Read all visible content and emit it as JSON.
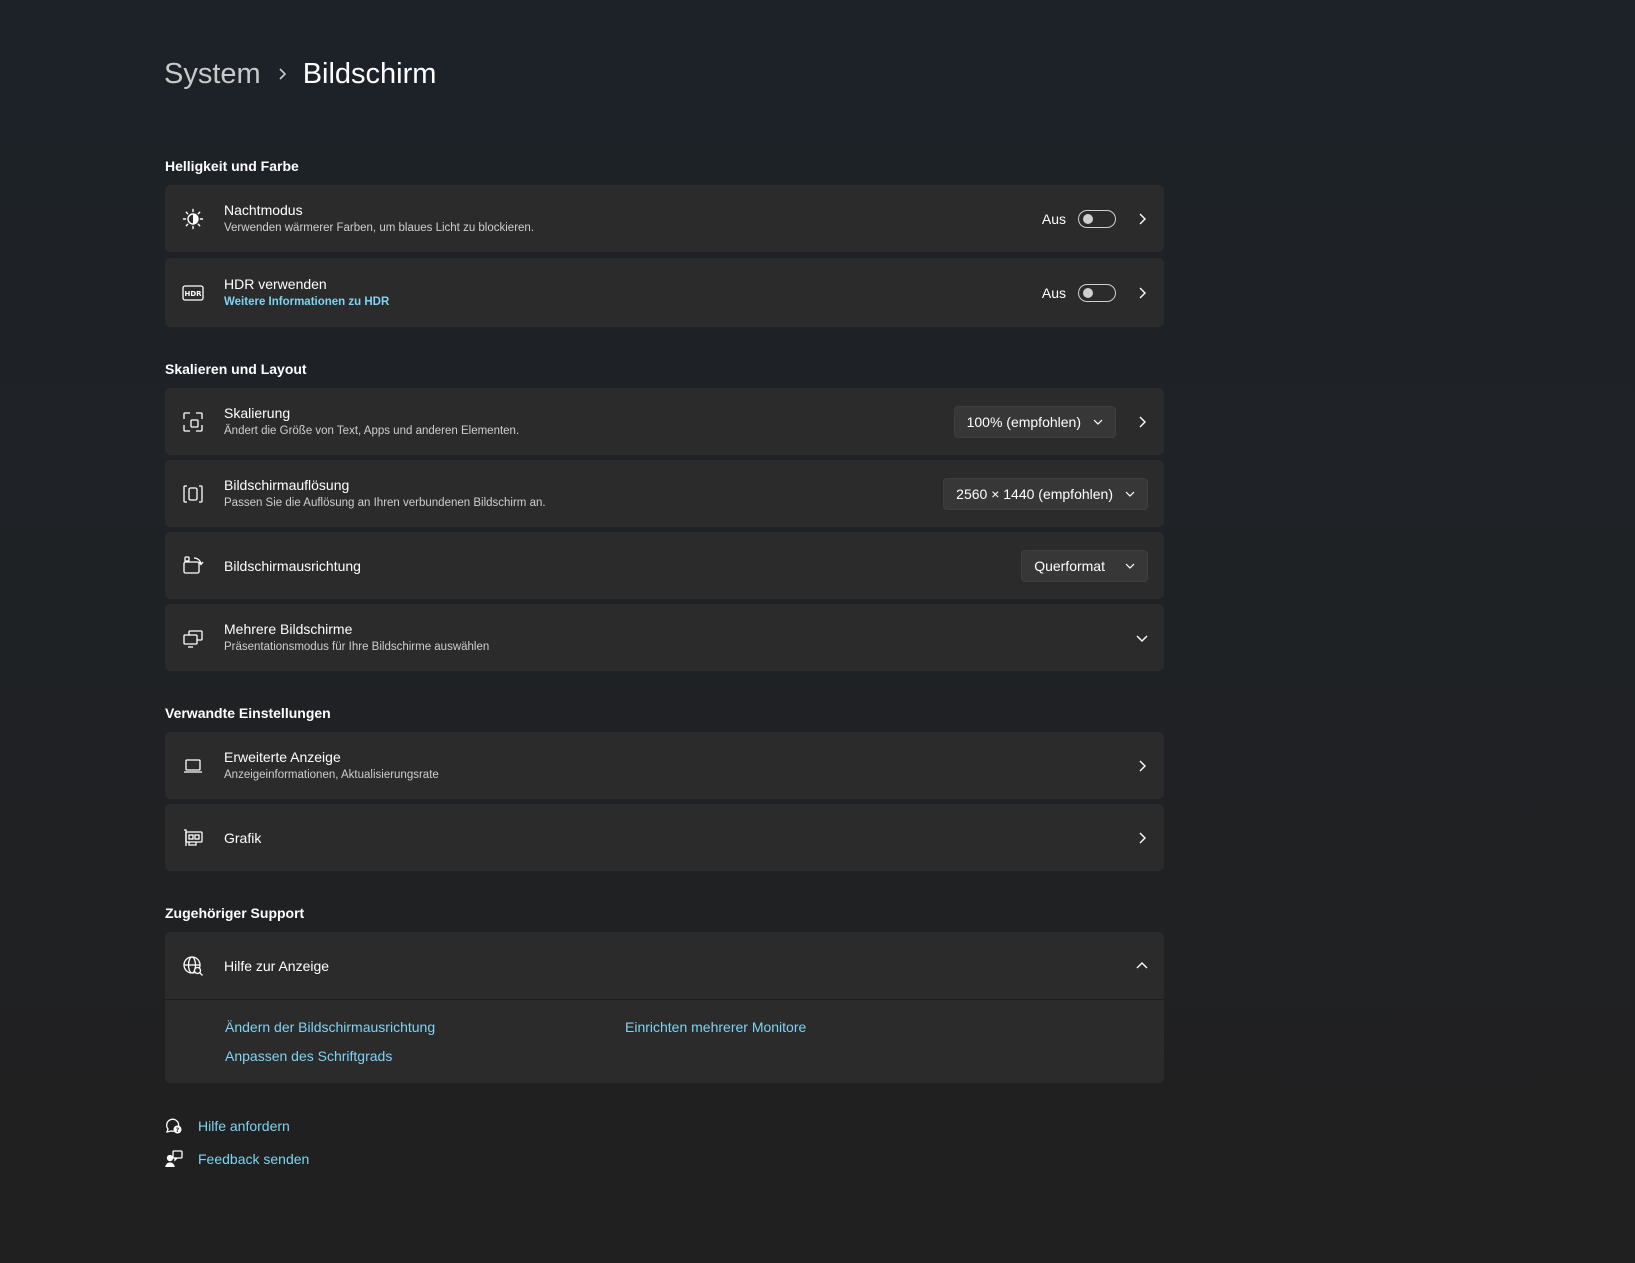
{
  "breadcrumb": {
    "parent": "System",
    "current": "Bildschirm"
  },
  "sections": {
    "brightness": "Helligkeit und Farbe",
    "scaling": "Skalieren und Layout",
    "related": "Verwandte Einstellungen",
    "support": "Zugehöriger Support"
  },
  "night_mode": {
    "title": "Nachtmodus",
    "description": "Verwenden wärmerer Farben, um blaues Licht zu blockieren.",
    "state": "Aus"
  },
  "hdr": {
    "title": "HDR verwenden",
    "link": "Weitere Informationen zu HDR",
    "state": "Aus"
  },
  "scale": {
    "title": "Skalierung",
    "description": "Ändert die Größe von Text, Apps und anderen Elementen.",
    "value": "100% (empfohlen)"
  },
  "resolution": {
    "title": "Bildschirmauflösung",
    "description": "Passen Sie die Auflösung an Ihren verbundenen Bildschirm an.",
    "value": "2560 × 1440 (empfohlen)"
  },
  "orientation": {
    "title": "Bildschirmausrichtung",
    "value": "Querformat"
  },
  "multiple_displays": {
    "title": "Mehrere Bildschirme",
    "description": "Präsentationsmodus für Ihre Bildschirme auswählen"
  },
  "advanced_display": {
    "title": "Erweiterte Anzeige",
    "description": "Anzeigeinformationen, Aktualisierungsrate"
  },
  "graphics": {
    "title": "Grafik"
  },
  "help": {
    "title": "Hilfe zur Anzeige",
    "links": [
      "Ändern der Bildschirmausrichtung",
      "Einrichten mehrerer Monitore",
      "Anpassen des Schriftgrads"
    ]
  },
  "footer": {
    "get_help": "Hilfe anfordern",
    "feedback": "Feedback senden"
  },
  "colors": {
    "accent_link": "#7fd3f3",
    "card": "#2b2b2b"
  }
}
